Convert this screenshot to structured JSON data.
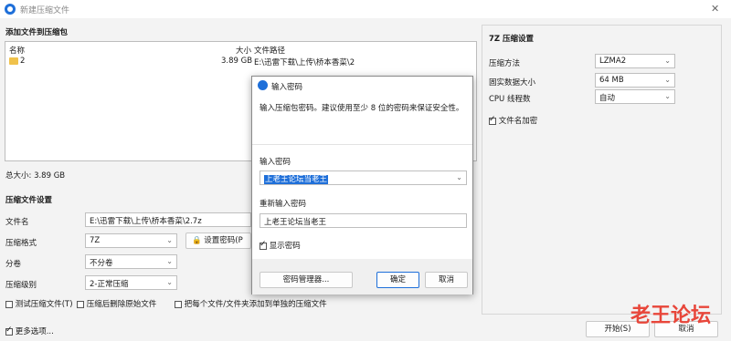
{
  "window": {
    "title": "新建压缩文件",
    "close_glyph": "✕"
  },
  "files": {
    "section_title": "添加文件到压缩包",
    "columns": {
      "name": "名称",
      "size": "大小",
      "path": "文件路径"
    },
    "rows": [
      {
        "name": "2",
        "size": "3.89 GB",
        "path": "E:\\迅雷下载\\上传\\桥本香菜\\2"
      }
    ],
    "total": "总大小: 3.89 GB"
  },
  "settings": {
    "section_title": "压缩文件设置",
    "filename_label": "文件名",
    "filename_value": "E:\\迅雷下载\\上传\\桥本香菜\\2.7z",
    "format_label": "压缩格式",
    "format_value": "7Z",
    "split_label": "分卷",
    "split_value": "不分卷",
    "level_label": "压缩级别",
    "level_value": "2-正常压缩",
    "set_password_label": "设置密码(P",
    "test_label": "测试压缩文件(T)",
    "delete_label": "压缩后删除原始文件",
    "separate_label": "把每个文件/文件夹添加到单独的压缩文件"
  },
  "sevenz": {
    "section_title": "7Z 压缩设置",
    "method_label": "压缩方法",
    "method_value": "LZMA2",
    "solid_label": "固实数据大小",
    "solid_value": "64 MB",
    "cpu_label": "CPU 线程数",
    "cpu_value": "自动",
    "encrypt_names_label": "文件名加密"
  },
  "footer": {
    "more_options": "更多选项...",
    "start": "开始(S)",
    "cancel": "取消"
  },
  "password_dialog": {
    "title": "输入密码",
    "hint": "输入压缩包密码。建议使用至少 8 位的密码来保证安全性。",
    "password_label": "输入密码",
    "password_value": "上老王论坛当老王",
    "reenter_label": "重新输入密码",
    "reenter_value": "上老王论坛当老王",
    "show_password_label": "显示密码",
    "manager_button": "密码管理器...",
    "ok_button": "确定",
    "cancel_button": "取消"
  },
  "watermark": {
    "text": "老王论坛"
  },
  "colors": {
    "accent": "#1e6fd9",
    "selection": "#1e6fd9",
    "watermark": "#e8463a"
  }
}
